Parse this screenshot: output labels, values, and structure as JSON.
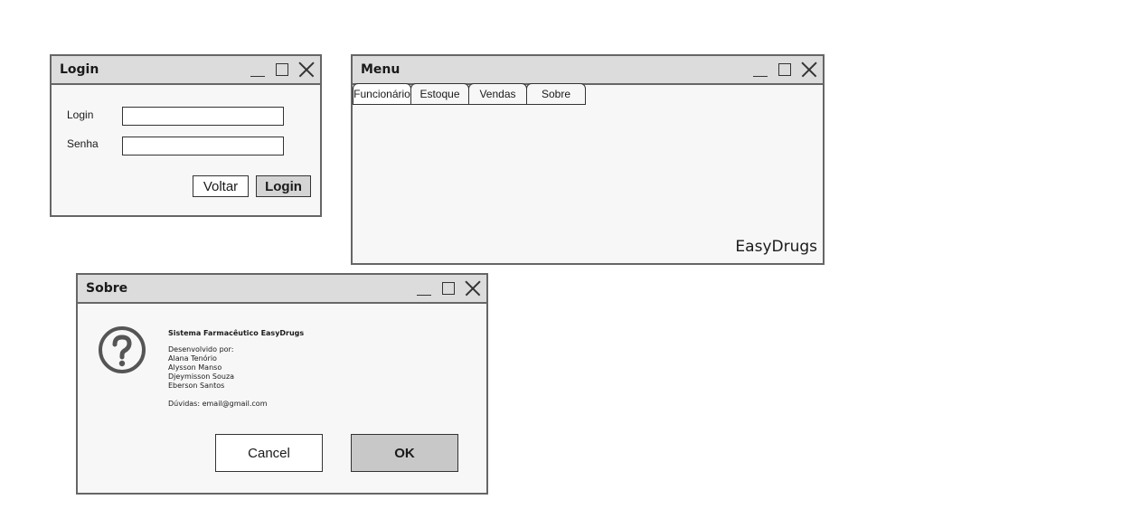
{
  "login_window": {
    "title": "Login",
    "login_label": "Login",
    "login_value": "",
    "password_label": "Senha",
    "password_value": "",
    "back_button": "Voltar",
    "login_button": "Login"
  },
  "menu_window": {
    "title": "Menu",
    "tabs": [
      {
        "label": "Funcionário"
      },
      {
        "label": "Estoque"
      },
      {
        "label": "Vendas"
      },
      {
        "label": "Sobre"
      }
    ],
    "brand": "EasyDrugs"
  },
  "about_window": {
    "title": "Sobre",
    "icon": "question-icon",
    "system_name": "Sistema Farmacêutico EasyDrugs",
    "developed_by": "Desenvolvido por:",
    "developers": [
      "Alana Tenório",
      "Alysson Manso",
      "Djeymisson Souza",
      "Eberson Santos"
    ],
    "contact": "Dúvidas: email@gmail.com",
    "cancel_button": "Cancel",
    "ok_button": "OK"
  },
  "window_controls": [
    "minimize-icon",
    "maximize-icon",
    "close-icon"
  ]
}
